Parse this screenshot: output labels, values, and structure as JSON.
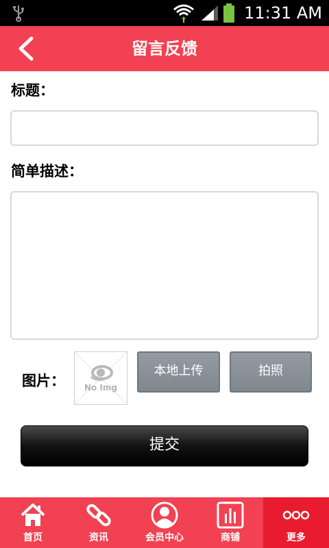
{
  "status_bar": {
    "time": "11:31 AM"
  },
  "header": {
    "title": "留言反馈",
    "back_icon": "chevron-left-icon"
  },
  "form": {
    "title_label": "标题：",
    "title_value": "",
    "desc_label": "简单描述：",
    "desc_value": "",
    "picture_label": "图片：",
    "thumbnail_text": "No Img",
    "local_upload_label": "本地上传",
    "take_photo_label": "拍照",
    "submit_label": "提交"
  },
  "bottom_nav": {
    "items": [
      {
        "label": "首页",
        "icon": "home-icon"
      },
      {
        "label": "资讯",
        "icon": "link-icon"
      },
      {
        "label": "会员中心",
        "icon": "user-icon"
      },
      {
        "label": "商铺",
        "icon": "bar-chart-icon"
      },
      {
        "label": "更多",
        "icon": "more-icon",
        "active": true
      }
    ]
  },
  "colors": {
    "accent": "#f14152",
    "accent_active": "#e81c2e",
    "button_gray": "#8a9199"
  }
}
